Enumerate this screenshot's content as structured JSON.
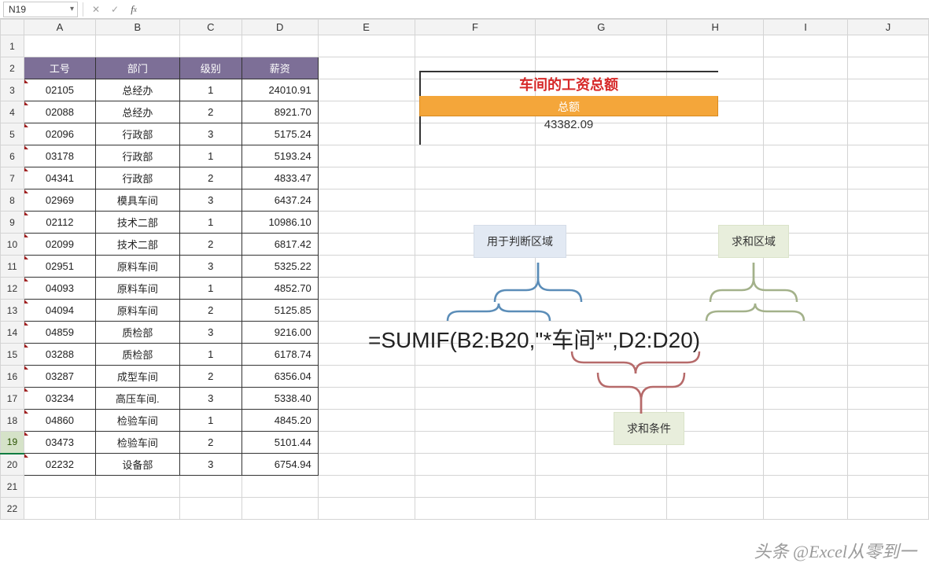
{
  "nameBox": "N19",
  "formula": "",
  "columns": [
    "A",
    "B",
    "C",
    "D",
    "E",
    "F",
    "G",
    "H",
    "I",
    "J"
  ],
  "rows": [
    1,
    2,
    3,
    4,
    5,
    6,
    7,
    8,
    9,
    10,
    11,
    12,
    13,
    14,
    15,
    16,
    17,
    18,
    19,
    20,
    21,
    22
  ],
  "selectedRow": 19,
  "table": {
    "headers": [
      "工号",
      "部门",
      "级别",
      "薪资"
    ],
    "rows": [
      [
        "02105",
        "总经办",
        "1",
        "24010.91"
      ],
      [
        "02088",
        "总经办",
        "2",
        "8921.70"
      ],
      [
        "02096",
        "行政部",
        "3",
        "5175.24"
      ],
      [
        "03178",
        "行政部",
        "1",
        "5193.24"
      ],
      [
        "04341",
        "行政部",
        "2",
        "4833.47"
      ],
      [
        "02969",
        "模具车间",
        "3",
        "6437.24"
      ],
      [
        "02112",
        "技术二部",
        "1",
        "10986.10"
      ],
      [
        "02099",
        "技术二部",
        "2",
        "6817.42"
      ],
      [
        "02951",
        "原料车间",
        "3",
        "5325.22"
      ],
      [
        "04093",
        "原料车间",
        "1",
        "4852.70"
      ],
      [
        "04094",
        "原料车间",
        "2",
        "5125.85"
      ],
      [
        "04859",
        "质检部",
        "3",
        "9216.00"
      ],
      [
        "03288",
        "质检部",
        "1",
        "6178.74"
      ],
      [
        "03287",
        "成型车间",
        "2",
        "6356.04"
      ],
      [
        "03234",
        "高压车间.",
        "3",
        "5338.40"
      ],
      [
        "04860",
        "检验车间",
        "1",
        "4845.20"
      ],
      [
        "03473",
        "检验车间",
        "2",
        "5101.44"
      ],
      [
        "02232",
        "设备部",
        "3",
        "6754.94"
      ]
    ]
  },
  "summary": {
    "title": "车间的工资总额",
    "label": "总额",
    "value": "43382.09"
  },
  "annotations": {
    "rangeLabel": "用于判断区域",
    "sumRangeLabel": "求和区域",
    "criteriaLabel": "求和条件",
    "formula": "=SUMIF(B2:B20,\"*车间*\",D2:D20)"
  },
  "watermark": "头条 @Excel从零到一",
  "icons": {
    "chevronDown": "▾",
    "cancel": "✕",
    "confirm": "✓"
  }
}
